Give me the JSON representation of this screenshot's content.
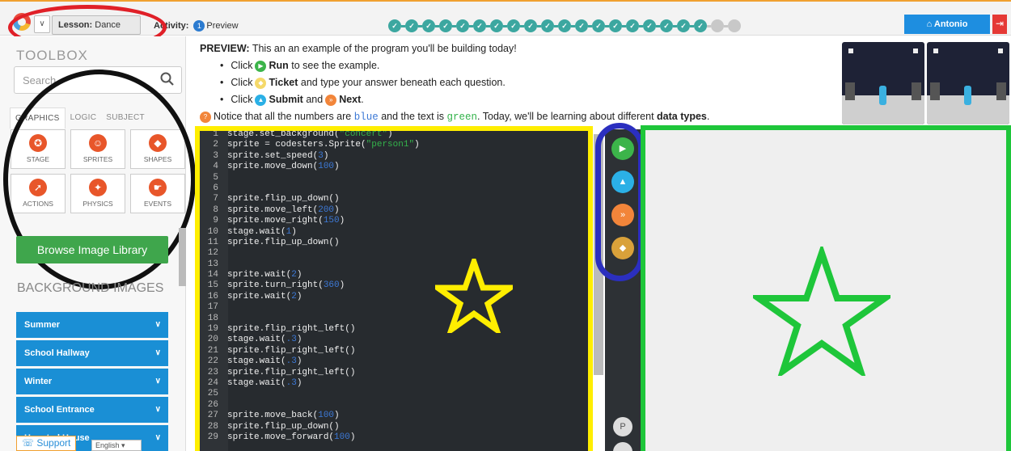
{
  "header": {
    "lesson_label": "Lesson:",
    "lesson_name": "Dance Steps",
    "activity_label": "Activity:",
    "activity_number": "1",
    "activity_name": "Preview",
    "progress": {
      "completed": 19,
      "total": 21
    },
    "user_name": "Antonio",
    "user_icon": "home-icon",
    "logout_icon": "logout-icon"
  },
  "toolbox": {
    "title": "TOOLBOX",
    "search_placeholder": "Search",
    "tabs": [
      "GRAPHICS",
      "LOGIC",
      "SUBJECT"
    ],
    "active_tab": "GRAPHICS",
    "tiles": [
      {
        "label": "STAGE",
        "icon": "stage-icon"
      },
      {
        "label": "SPRITES",
        "icon": "sprites-icon"
      },
      {
        "label": "SHAPES",
        "icon": "shapes-icon"
      },
      {
        "label": "ACTIONS",
        "icon": "actions-icon"
      },
      {
        "label": "PHYSICS",
        "icon": "physics-icon"
      },
      {
        "label": "EVENTS",
        "icon": "events-icon"
      }
    ],
    "browse_button": "Browse Image Library",
    "background_title": "BACKGROUND IMAGES",
    "background_items": [
      "Summer",
      "School Hallway",
      "Winter",
      "School Entrance",
      "Haunted House"
    ],
    "support": "Support",
    "language": "English"
  },
  "instructions": {
    "preview_label": "PREVIEW:",
    "preview_text": "This an an example of the program you'll be building today!",
    "step1_prefix": "Click",
    "step1_bold": "Run",
    "step1_suffix": "to see the example.",
    "step2_prefix": "Click",
    "step2_bold": "Ticket",
    "step2_suffix": "and type your answer beneath each question.",
    "step3_prefix": "Click",
    "step3_bold1": "Submit",
    "step3_mid": "and",
    "step3_bold2": "Next",
    "step3_suffix": ".",
    "notice_1": "Notice that all the numbers are",
    "notice_blue": "blue",
    "notice_2": "and the text is",
    "notice_green": "green",
    "notice_3": ". Today, we'll be learning about different",
    "notice_bold": "data types",
    "notice_4": "."
  },
  "code_lines": [
    "stage.set_background(\"concert\")",
    "sprite = codesters.Sprite(\"person1\")",
    "sprite.set_speed(3)",
    "sprite.move_down(100)",
    "",
    "",
    "sprite.flip_up_down()",
    "sprite.move_left(200)",
    "sprite.move_right(150)",
    "stage.wait(1)",
    "sprite.flip_up_down()",
    "",
    "",
    "sprite.wait(2)",
    "sprite.turn_right(360)",
    "sprite.wait(2)",
    "",
    "",
    "sprite.flip_right_left()",
    "stage.wait(.3)",
    "sprite.flip_right_left()",
    "stage.wait(.3)",
    "sprite.flip_right_left()",
    "stage.wait(.3)",
    "",
    "",
    "sprite.move_back(100)",
    "sprite.flip_up_down()",
    "sprite.move_forward(100)"
  ],
  "side_buttons": {
    "run": "run-icon",
    "submit": "submit-icon",
    "next": "next-icon",
    "ticket": "ticket-icon",
    "p_label": "P"
  },
  "colors": {
    "number": "#3d79d6",
    "string": "#34b34b",
    "run": "#3cb44a",
    "submit": "#2bb0e6",
    "next": "#f2853a",
    "ticket": "#d9a13a"
  }
}
